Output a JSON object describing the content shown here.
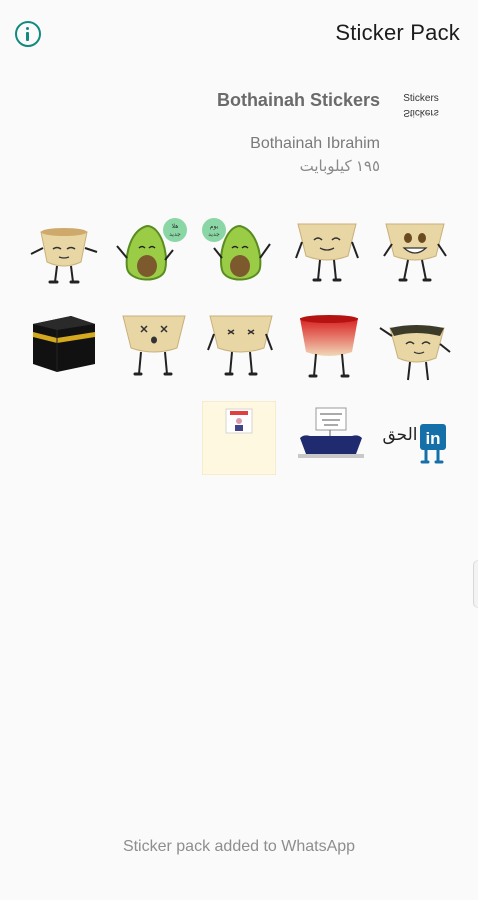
{
  "appbar": {
    "title": "Sticker Pack",
    "info_icon": "info-icon"
  },
  "pack": {
    "name": "Bothainah Stickers",
    "publisher": "Bothainah Ibrahim",
    "size": "١٩٥ كيلوبايت",
    "tray_icon": "tray-icon",
    "tray_text": [
      "Stickers",
      "Stickers"
    ]
  },
  "stickers": [
    {
      "icon": "cup-sticker"
    },
    {
      "icon": "avocado-sticker",
      "bubble": [
        "هلا",
        "جديد"
      ]
    },
    {
      "icon": "avocado-sticker",
      "bubble": [
        "يوم",
        "جديد"
      ]
    },
    {
      "icon": "cup-sticker"
    },
    {
      "icon": "cup-sticker"
    },
    {
      "icon": "kaaba-sticker"
    },
    {
      "icon": "cup-sticker"
    },
    {
      "icon": "cup-sticker"
    },
    {
      "icon": "red-cup-sticker"
    },
    {
      "icon": "cup-sticker"
    },
    {
      "icon": "card-sticker"
    },
    {
      "icon": "sign-sticker"
    },
    {
      "icon": "linkedin-sticker",
      "text": "الحق",
      "badge": "in"
    }
  ],
  "colors": {
    "accent": "#138a7e",
    "cup": "#e9d6a5"
  },
  "footer": {
    "status": "Sticker pack added to WhatsApp"
  }
}
